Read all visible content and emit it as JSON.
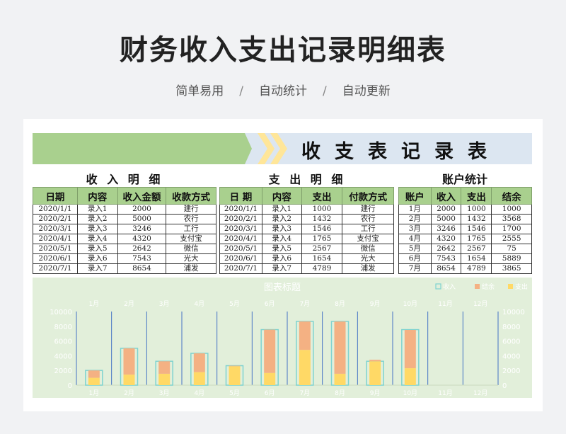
{
  "header": {
    "title": "财务收入支出记录明细表",
    "tags": [
      "简单易用",
      "自动统计",
      "自动更新"
    ],
    "separator": "/"
  },
  "banner": {
    "title": "收支表记录表"
  },
  "income": {
    "title": "收 入 明 细",
    "columns": [
      "日期",
      "内容",
      "收入金额",
      "收款方式"
    ],
    "rows": [
      [
        "2020/1/1",
        "录入1",
        "2000",
        "建行"
      ],
      [
        "2020/2/1",
        "录入2",
        "5000",
        "农行"
      ],
      [
        "2020/3/1",
        "录入3",
        "3246",
        "工行"
      ],
      [
        "2020/4/1",
        "录入4",
        "4320",
        "支付宝"
      ],
      [
        "2020/5/1",
        "录入5",
        "2642",
        "微信"
      ],
      [
        "2020/6/1",
        "录入6",
        "7543",
        "光大"
      ],
      [
        "2020/7/1",
        "录入7",
        "8654",
        "浦发"
      ]
    ]
  },
  "expense": {
    "title": "支 出 明 细",
    "columns": [
      "日 期",
      "内容",
      "支出",
      "付款方式"
    ],
    "rows": [
      [
        "2020/1/1",
        "录入1",
        "1000",
        "建行"
      ],
      [
        "2020/2/1",
        "录入2",
        "1432",
        "农行"
      ],
      [
        "2020/3/1",
        "录入3",
        "1546",
        "工行"
      ],
      [
        "2020/4/1",
        "录入4",
        "1765",
        "支付宝"
      ],
      [
        "2020/5/1",
        "录入5",
        "2567",
        "微信"
      ],
      [
        "2020/6/1",
        "录入6",
        "1654",
        "光大"
      ],
      [
        "2020/7/1",
        "录入7",
        "4789",
        "浦发"
      ]
    ]
  },
  "account": {
    "title": "账户统计",
    "columns": [
      "账户",
      "收入",
      "支出",
      "结余"
    ],
    "rows": [
      [
        "1月",
        "2000",
        "1000",
        "1000"
      ],
      [
        "2月",
        "5000",
        "1432",
        "3568"
      ],
      [
        "3月",
        "3246",
        "1546",
        "1700"
      ],
      [
        "4月",
        "4320",
        "1765",
        "2555"
      ],
      [
        "5月",
        "2642",
        "2567",
        "75"
      ],
      [
        "6月",
        "7543",
        "1654",
        "5889"
      ],
      [
        "7月",
        "8654",
        "4789",
        "3865"
      ]
    ]
  },
  "chart_data": {
    "type": "bar",
    "title": "图表标题",
    "categories": [
      "1月",
      "2月",
      "3月",
      "4月",
      "5月",
      "6月",
      "7月",
      "8月",
      "9月",
      "10月",
      "11月",
      "12月"
    ],
    "series": [
      {
        "name": "收入",
        "values": [
          2000,
          5000,
          3246,
          4320,
          2642,
          7543,
          8654,
          8654,
          3246,
          7543,
          0,
          0
        ]
      },
      {
        "name": "结余",
        "values": [
          1000,
          3568,
          1700,
          2555,
          75,
          5889,
          3865,
          7100,
          200,
          5200,
          0,
          0
        ]
      },
      {
        "name": "支出",
        "values": [
          1000,
          1432,
          1546,
          1765,
          2567,
          1654,
          4789,
          1546,
          3246,
          2300,
          0,
          0
        ]
      }
    ],
    "ylim": [
      0,
      10000
    ],
    "yticks": [
      0,
      2000,
      4000,
      6000,
      8000,
      10000
    ],
    "y2ticks": [
      0,
      2000,
      4000,
      6000,
      8000,
      10000
    ],
    "legend": "top-right",
    "colors": {
      "income": "#7fd3d0",
      "balance": "#f4b183",
      "expense": "#ffd966",
      "background": "#e2efda",
      "gridline": "#4472c4"
    }
  }
}
